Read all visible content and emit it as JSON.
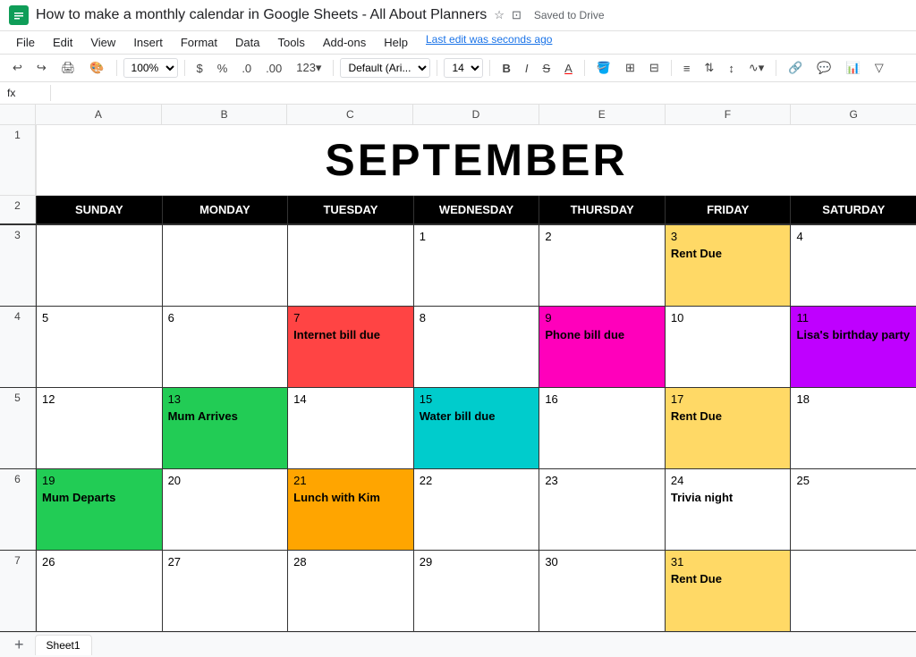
{
  "window": {
    "title": "How to make a monthly calendar in Google Sheets - All About Planners",
    "saved": "Saved to Drive",
    "last_edit": "Last edit was seconds ago"
  },
  "menus": [
    "File",
    "Edit",
    "View",
    "Insert",
    "Format",
    "Data",
    "Tools",
    "Add-ons",
    "Help"
  ],
  "toolbar": {
    "zoom": "100%",
    "currency": "$",
    "percent": "%",
    "decimal0": ".0",
    "decimal2": ".00",
    "format123": "123▾",
    "font": "Default (Ari...",
    "font_size": "14",
    "bold": "B",
    "italic": "I",
    "strikethrough": "S",
    "underline": "A"
  },
  "formula_bar": {
    "cell_ref": "fx"
  },
  "calendar": {
    "month": "SEPTEMBER",
    "days_of_week": [
      "SUNDAY",
      "MONDAY",
      "TUESDAY",
      "WEDNESDAY",
      "THURSDAY",
      "FRIDAY",
      "SATURDAY"
    ],
    "col_headers": [
      "",
      "A",
      "B",
      "C",
      "D",
      "E",
      "F",
      "G"
    ],
    "rows": [
      {
        "row_num": "1",
        "type": "title"
      },
      {
        "row_num": "2",
        "type": "headers"
      },
      {
        "row_num": "3",
        "cells": [
          {
            "day": "",
            "event": "",
            "bg": ""
          },
          {
            "day": "",
            "event": "",
            "bg": ""
          },
          {
            "day": "",
            "event": "",
            "bg": ""
          },
          {
            "day": "1",
            "event": "",
            "bg": ""
          },
          {
            "day": "2",
            "event": "",
            "bg": ""
          },
          {
            "day": "3",
            "event": "Rent Due",
            "bg": "yellow",
            "event_color": "black"
          },
          {
            "day": "4",
            "event": "",
            "bg": ""
          }
        ]
      },
      {
        "row_num": "4",
        "cells": [
          {
            "day": "5",
            "event": "",
            "bg": ""
          },
          {
            "day": "6",
            "event": "",
            "bg": ""
          },
          {
            "day": "7",
            "event": "Internet bill due",
            "bg": "red",
            "event_color": "black"
          },
          {
            "day": "8",
            "event": "",
            "bg": ""
          },
          {
            "day": "9",
            "event": "Phone bill due",
            "bg": "magenta",
            "event_color": "black"
          },
          {
            "day": "10",
            "event": "",
            "bg": ""
          },
          {
            "day": "11",
            "event": "Lisa's birthday party",
            "bg": "purple",
            "event_color": "black"
          }
        ]
      },
      {
        "row_num": "5",
        "cells": [
          {
            "day": "12",
            "event": "",
            "bg": ""
          },
          {
            "day": "13",
            "event": "Mum Arrives",
            "bg": "green",
            "event_color": "black"
          },
          {
            "day": "14",
            "event": "",
            "bg": ""
          },
          {
            "day": "15",
            "event": "Water bill due",
            "bg": "cyan",
            "event_color": "black"
          },
          {
            "day": "16",
            "event": "",
            "bg": ""
          },
          {
            "day": "17",
            "event": "Rent Due",
            "bg": "yellow",
            "event_color": "black"
          },
          {
            "day": "18",
            "event": "",
            "bg": ""
          }
        ]
      },
      {
        "row_num": "6",
        "cells": [
          {
            "day": "19",
            "event": "Mum Departs",
            "bg": "green",
            "event_color": "black"
          },
          {
            "day": "20",
            "event": "",
            "bg": ""
          },
          {
            "day": "21",
            "event": "Lunch with Kim",
            "bg": "orange",
            "event_color": "black"
          },
          {
            "day": "22",
            "event": "",
            "bg": ""
          },
          {
            "day": "23",
            "event": "",
            "bg": ""
          },
          {
            "day": "24",
            "event": "Trivia night",
            "bg": "",
            "event_color": "black"
          },
          {
            "day": "25",
            "event": "",
            "bg": ""
          }
        ]
      },
      {
        "row_num": "7",
        "cells": [
          {
            "day": "26",
            "event": "",
            "bg": ""
          },
          {
            "day": "27",
            "event": "",
            "bg": ""
          },
          {
            "day": "28",
            "event": "",
            "bg": ""
          },
          {
            "day": "29",
            "event": "",
            "bg": ""
          },
          {
            "day": "30",
            "event": "",
            "bg": ""
          },
          {
            "day": "31",
            "event": "Rent Due",
            "bg": "yellow",
            "event_color": "black"
          },
          {
            "day": "",
            "event": "",
            "bg": ""
          }
        ]
      }
    ]
  },
  "sheet_tab": "Sheet1"
}
